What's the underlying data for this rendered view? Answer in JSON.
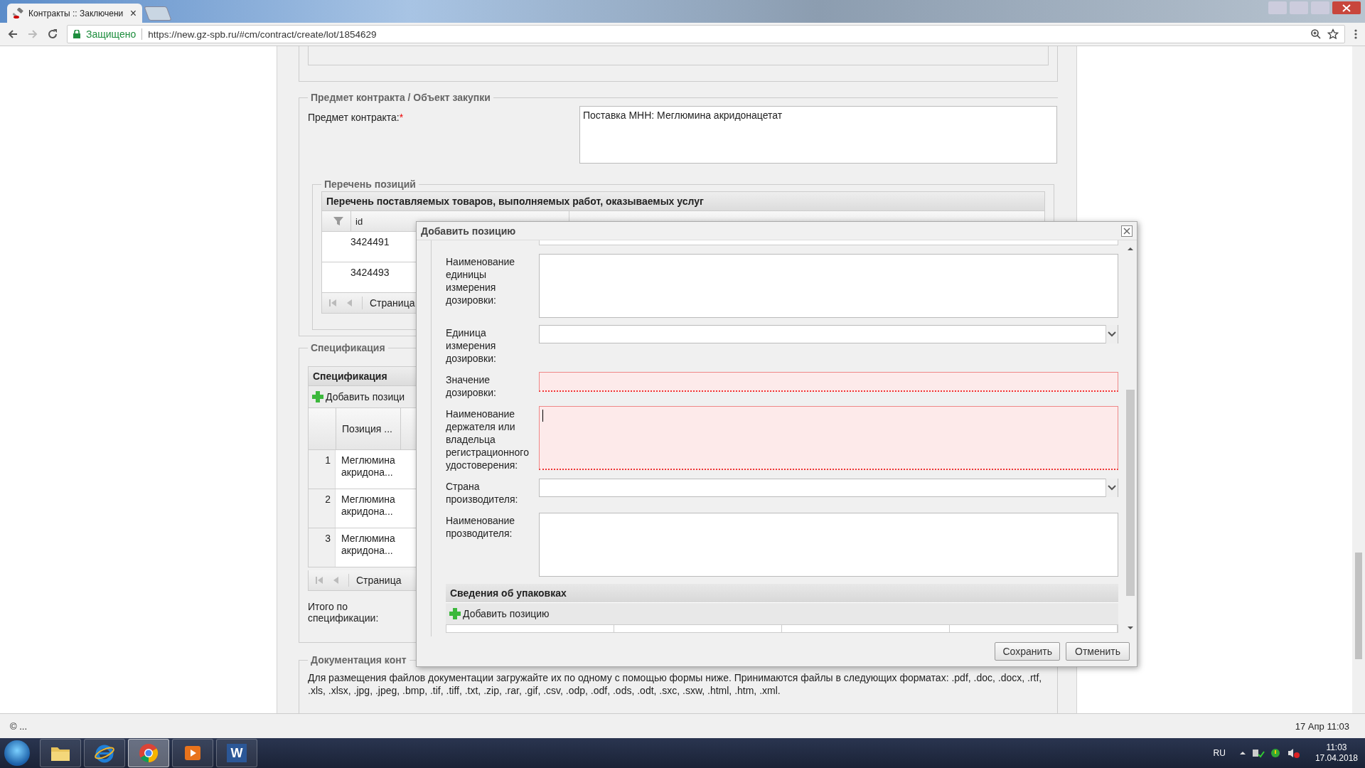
{
  "browser": {
    "tab_title": "Контракты :: Заключени",
    "tab_close": "×",
    "secure_label": "Защищено",
    "url": "https://new.gz-spb.ru/#cm/contract/create/lot/1854629"
  },
  "page": {
    "subject_section": {
      "legend": "Предмет контракта / Объект закупки",
      "field_label": "Предмет контракта:",
      "required_mark": "*",
      "value": "Поставка МНН: Меглюмина акридонацетат"
    },
    "positions_section": {
      "legend": "Перечень позиций",
      "grid_title": "Перечень поставляемых товаров, выполняемых работ, оказываемых услуг",
      "columns": [
        "id"
      ],
      "rows": [
        "3424491",
        "3424493"
      ],
      "pager_label": "Страница"
    },
    "spec_section": {
      "legend": "Спецификация",
      "grid_title": "Спецификация",
      "add_button": "Добавить позици",
      "columns": [
        "Позиция ..."
      ],
      "rows": [
        {
          "number": "1",
          "position": "Меглюмина акридона..."
        },
        {
          "number": "2",
          "position": "Меглюмина акридона..."
        },
        {
          "number": "3",
          "position": "Меглюмина акридона..."
        }
      ],
      "pager_label": "Страница",
      "total_label": "Итого по спецификации:"
    },
    "docs_section": {
      "legend": "Документация конт",
      "text": "Для размещения файлов документации загружайте их по одному с помощью формы ниже. Принимаются файлы в следующих форматах: .pdf, .doc, .docx, .rtf, .xls, .xlsx, .jpg, .jpeg, .bmp, .tif, .tiff, .txt, .zip, .rar, .gif, .csv, .odp, .odf, .ods, .odt, .sxc, .sxw, .html, .htm, .xml."
    }
  },
  "dialog": {
    "title": "Добавить позицию",
    "fields": [
      {
        "kind": "textarea",
        "label": "Наименование единицы измерения дозировки:",
        "invalid": false,
        "focused": false
      },
      {
        "kind": "combo",
        "label": "Единица измерения дозировки:",
        "invalid": false,
        "focused": false
      },
      {
        "kind": "text",
        "label": "Значение дозировки:",
        "invalid": true,
        "focused": false
      },
      {
        "kind": "textarea",
        "label": "Наименование держателя или владельца регистрационного удостоверения:",
        "invalid": true,
        "focused": true
      },
      {
        "kind": "combo",
        "label": "Страна производителя:",
        "invalid": false,
        "focused": false
      },
      {
        "kind": "textarea",
        "label": "Наименование прозводителя:",
        "invalid": false,
        "focused": false
      }
    ],
    "packaging": {
      "title": "Сведения об упаковках",
      "add_button": "Добавить позицию"
    },
    "buttons": [
      "Сохранить",
      "Отменить"
    ]
  },
  "status_bar": {
    "left": "© ...",
    "right": "17 Апр 11:03"
  },
  "taskbar": {
    "apps": [
      {
        "kind": "explorer",
        "selected": false
      },
      {
        "kind": "ie",
        "selected": false
      },
      {
        "kind": "chrome",
        "selected": true
      },
      {
        "kind": "media",
        "selected": false
      },
      {
        "kind": "word",
        "selected": false,
        "label": "W"
      }
    ],
    "language": "RU",
    "time": "11:03",
    "date": "17.04.2018"
  }
}
